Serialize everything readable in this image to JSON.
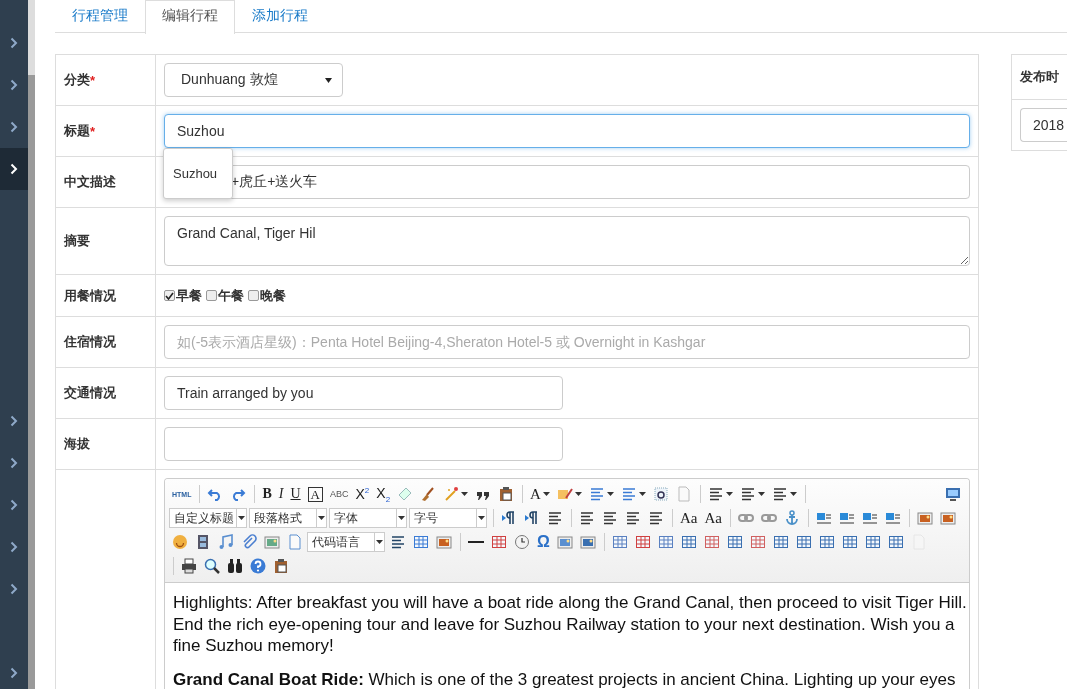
{
  "sidebar": {
    "items": [
      {
        "kind": "link",
        "selected": false
      },
      {
        "kind": "link",
        "selected": false
      },
      {
        "kind": "link",
        "selected": false
      },
      {
        "kind": "link",
        "selected": true
      },
      {
        "kind": "blank"
      },
      {
        "kind": "blank"
      },
      {
        "kind": "blank"
      },
      {
        "kind": "blank"
      },
      {
        "kind": "blank"
      },
      {
        "kind": "link",
        "selected": false
      },
      {
        "kind": "link",
        "selected": false
      },
      {
        "kind": "link",
        "selected": false
      },
      {
        "kind": "link",
        "selected": false
      },
      {
        "kind": "link",
        "selected": false
      },
      {
        "kind": "blank"
      },
      {
        "kind": "link",
        "selected": false
      }
    ]
  },
  "tabs": [
    {
      "label": "行程管理",
      "selected": false
    },
    {
      "label": "编辑行程",
      "selected": true
    },
    {
      "label": "添加行程",
      "selected": false
    }
  ],
  "form": {
    "rows": [
      {
        "kind": "select",
        "label": "分类",
        "required_mark": "*",
        "value": "Dunhuang 敦煌"
      },
      {
        "kind": "input",
        "label": "标题",
        "required_mark": "*",
        "value": "Suzhou",
        "focused": true,
        "suggestions": [
          "Suzhou"
        ]
      },
      {
        "kind": "input",
        "label": "中文描述",
        "value": "+虎丘+送火车",
        "covered": true
      },
      {
        "kind": "textarea",
        "label": "摘要",
        "value": "Grand Canal, Tiger Hil"
      },
      {
        "kind": "checks",
        "label": "用餐情况",
        "options": [
          {
            "label": "早餐",
            "checked": true
          },
          {
            "label": "午餐",
            "checked": false
          },
          {
            "label": "晚餐",
            "checked": false
          }
        ]
      },
      {
        "kind": "input",
        "label": "住宿情况",
        "placeholder": "如(-5表示酒店星级)：Penta Hotel Beijing-4,Sheraton Hotel-5 或 Overnight in Kashgar"
      },
      {
        "kind": "short",
        "label": "交通情况",
        "value": "Train arranged by you"
      },
      {
        "kind": "short",
        "label": "海拔"
      },
      {
        "kind": "editor"
      }
    ]
  },
  "editor": {
    "toolbar": [
      [
        {
          "kind": "small",
          "label": "HTML"
        },
        {
          "kind": "sep"
        },
        {
          "kind": "icon"
        },
        {
          "kind": "icon"
        },
        {
          "kind": "sep"
        },
        {
          "kind": "bold",
          "label": "B"
        },
        {
          "kind": "italic",
          "label": "I"
        },
        {
          "kind": "underline",
          "label": "U"
        },
        {
          "kind": "boxed",
          "label": "A"
        },
        {
          "kind": "strike",
          "label": "ABC"
        },
        {
          "kind": "script",
          "label": "X$^{2}$"
        },
        {
          "kind": "script",
          "label": "X$_{2}$"
        },
        {
          "kind": "icon"
        },
        {
          "kind": "icon"
        },
        {
          "kind": "icon",
          "menu": true
        },
        {
          "kind": "icon"
        },
        {
          "kind": "icon"
        },
        {
          "kind": "sep"
        },
        {
          "kind": "serif",
          "label": "A",
          "menu": true
        },
        {
          "kind": "icon",
          "menu": true
        },
        {
          "kind": "icon",
          "menu": true
        },
        {
          "kind": "icon",
          "menu": true
        },
        {
          "kind": "icon"
        },
        {
          "kind": "icon"
        },
        {
          "kind": "sep"
        },
        {
          "kind": "icon",
          "menu": true
        },
        {
          "kind": "icon",
          "menu": true
        },
        {
          "kind": "icon",
          "menu": true
        },
        {
          "kind": "sep"
        },
        {
          "kind": "spacer"
        },
        {
          "kind": "icon"
        }
      ],
      [
        {
          "kind": "select",
          "label": "自定义标题"
        },
        {
          "kind": "select",
          "label": "段落格式"
        },
        {
          "kind": "select",
          "label": "字体"
        },
        {
          "kind": "select",
          "label": "字号"
        },
        {
          "kind": "sep"
        },
        {
          "kind": "icon"
        },
        {
          "kind": "icon"
        },
        {
          "kind": "icon"
        },
        {
          "kind": "sep"
        },
        {
          "kind": "icon"
        },
        {
          "kind": "icon"
        },
        {
          "kind": "icon"
        },
        {
          "kind": "icon"
        },
        {
          "kind": "sep"
        },
        {
          "kind": "serif",
          "label": "Aa"
        },
        {
          "kind": "serif",
          "label": "Aa"
        },
        {
          "kind": "sep"
        },
        {
          "kind": "icon"
        },
        {
          "kind": "icon"
        },
        {
          "kind": "icon"
        },
        {
          "kind": "sep"
        },
        {
          "kind": "icon"
        },
        {
          "kind": "icon"
        },
        {
          "kind": "icon"
        },
        {
          "kind": "icon"
        },
        {
          "kind": "sep"
        },
        {
          "kind": "icon"
        },
        {
          "kind": "icon"
        }
      ],
      [
        {
          "kind": "icon"
        },
        {
          "kind": "icon"
        },
        {
          "kind": "icon"
        },
        {
          "kind": "icon"
        },
        {
          "kind": "icon"
        },
        {
          "kind": "icon"
        },
        {
          "kind": "select",
          "label": "代码语言"
        },
        {
          "kind": "icon"
        },
        {
          "kind": "icon"
        },
        {
          "kind": "icon"
        },
        {
          "kind": "sep"
        },
        {
          "kind": "icon"
        },
        {
          "kind": "icon"
        },
        {
          "kind": "icon"
        },
        {
          "kind": "omega",
          "label": "Ω"
        },
        {
          "kind": "icon"
        },
        {
          "kind": "icon"
        },
        {
          "kind": "sep"
        },
        {
          "kind": "icon"
        },
        {
          "kind": "icon"
        },
        {
          "kind": "icon"
        },
        {
          "kind": "icon"
        },
        {
          "kind": "icon"
        },
        {
          "kind": "icon"
        },
        {
          "kind": "icon"
        },
        {
          "kind": "icon"
        },
        {
          "kind": "icon"
        },
        {
          "kind": "icon"
        },
        {
          "kind": "icon"
        },
        {
          "kind": "icon"
        },
        {
          "kind": "icon"
        },
        {
          "kind": "icon",
          "disabled": true
        }
      ],
      [
        {
          "kind": "sep"
        },
        {
          "kind": "icon"
        },
        {
          "kind": "icon"
        },
        {
          "kind": "icon"
        },
        {
          "kind": "icon"
        },
        {
          "kind": "icon"
        }
      ]
    ],
    "paragraphs": [
      "Highlights: After breakfast you will have a boat ride along the Grand Canal, then proceed to visit Tiger Hill. End the rich eye-opening tour and leave for Suzhou Railway station to your next destination. Wish you a fine Suzhou memory!",
      "**Grand Canal Boat Ride:** Which is one of the 3 greatest projects in ancient China. Lighting up your eyes"
    ]
  },
  "side_panel": {
    "title": "发布时",
    "value": "2018"
  }
}
